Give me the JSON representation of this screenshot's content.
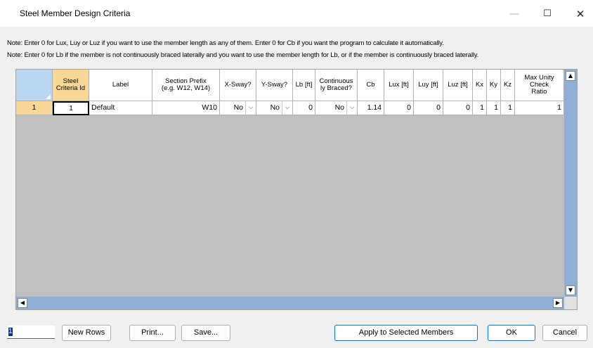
{
  "window": {
    "title": "Steel Member Design Criteria",
    "minimize": "—",
    "maximize": "☐",
    "close": "✕"
  },
  "notes": [
    "Note: Enter 0 for Lux, Luy or Luz if you want to use the member length as any of them.  Enter 0 for Cb if you want the program to calculate it automatically.",
    "Note: Enter 0 for Lb if the member is not continuously braced laterally and  you want to use the member length for Lb, or if the member is continuously braced laterally."
  ],
  "grid": {
    "headers": [
      "Steel\nCriteria Id",
      "Label",
      "Section Prefix\n(e.g. W12, W14)",
      "X-Sway?",
      "Y-Sway?",
      "Lb [ft]",
      "Continuous\nly Braced?",
      "Cb",
      "Lux [ft]",
      "Luy [ft]",
      "Luz [ft]",
      "Kx",
      "Ky",
      "Kz",
      "Max Unity\nCheck\nRatio"
    ],
    "rows": [
      {
        "row_number": "1",
        "criteria_id": "1",
        "label": "Default",
        "section_prefix": "W10",
        "x_sway": "No",
        "y_sway": "No",
        "lb": "0",
        "continuously_braced": "No",
        "cb": "1.14",
        "lux": "0",
        "luy": "0",
        "luz": "0",
        "kx": "1",
        "ky": "1",
        "kz": "1",
        "max_unity": "1"
      }
    ]
  },
  "footer": {
    "row_count": "1",
    "new_rows": "New Rows",
    "print": "Print...",
    "save": "Save...",
    "apply": "Apply to Selected Members",
    "ok": "OK",
    "cancel": "Cancel"
  },
  "colors": {
    "row_header": "#fbd796",
    "corner": "#b9d6f2",
    "scrollbar": "#8fb0d6",
    "grid_empty": "#c0c0c0",
    "focus_border": "#0078d4"
  },
  "icons": {
    "dropdown": "chevron-down-icon",
    "scroll_up": "triangle-up-icon",
    "scroll_down": "triangle-down-icon",
    "scroll_left": "triangle-left-icon",
    "scroll_right": "triangle-right-icon"
  }
}
